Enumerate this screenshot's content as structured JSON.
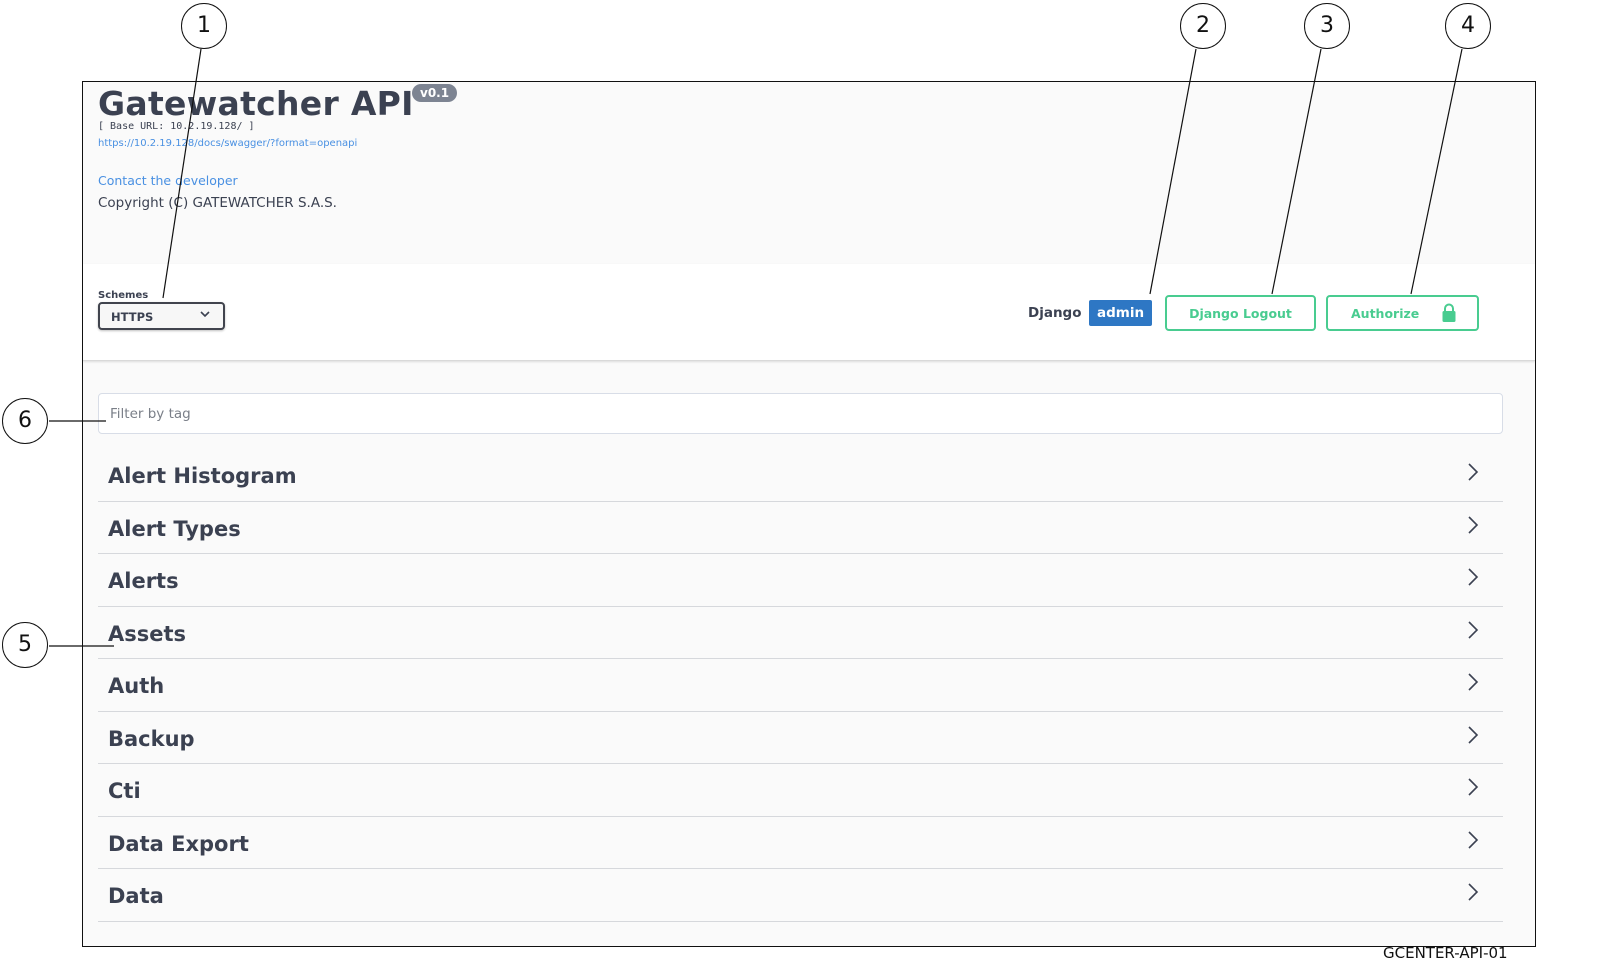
{
  "info": {
    "title": "Gatewatcher API",
    "version": "v0.1",
    "base_url": "[ Base URL: 10.2.19.128/ ]",
    "spec_url": "https://10.2.19.128/docs/swagger/?format=openapi",
    "contact": "Contact the developer",
    "copyright": "Copyright (C) GATEWATCHER S.A.S."
  },
  "schemes": {
    "label": "Schemes",
    "selected": "HTTPS"
  },
  "auth": {
    "django_label": "Django",
    "user": "admin",
    "logout_label": "Django Logout",
    "authorize_label": "Authorize"
  },
  "filter": {
    "placeholder": "Filter by tag",
    "value": ""
  },
  "tags": [
    {
      "name": "Alert Histogram"
    },
    {
      "name": "Alert Types"
    },
    {
      "name": "Alerts"
    },
    {
      "name": "Assets"
    },
    {
      "name": "Auth"
    },
    {
      "name": "Backup"
    },
    {
      "name": "Cti"
    },
    {
      "name": "Data Export"
    },
    {
      "name": "Data"
    }
  ],
  "callouts": [
    "1",
    "2",
    "3",
    "4",
    "5",
    "6"
  ],
  "figure_id": "GCENTER-API-01",
  "colors": {
    "text": "#3b4151",
    "link": "#4990e2",
    "accent_green": "#49cc90",
    "user_badge": "#2e77c4",
    "version_badge": "#7d8492"
  },
  "icons": {
    "scheme_dropdown": "chevron-down-icon",
    "authorize": "lock-icon",
    "tag_expand": "chevron-right-icon"
  }
}
